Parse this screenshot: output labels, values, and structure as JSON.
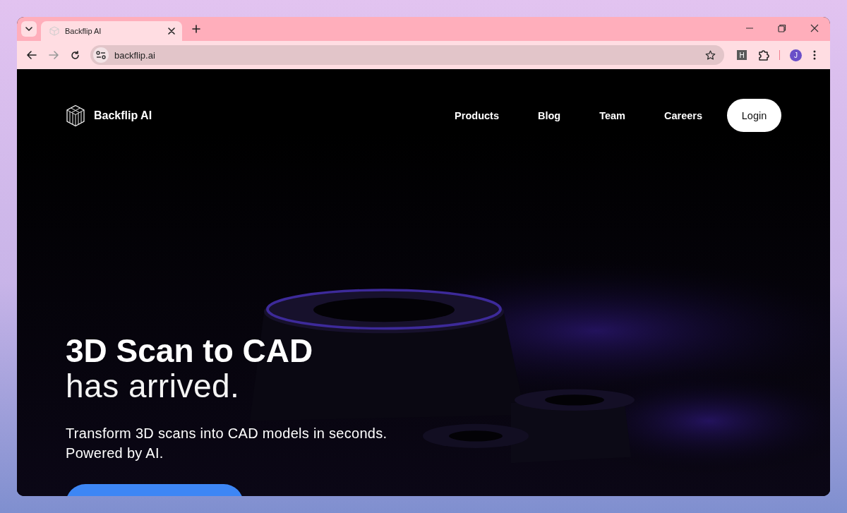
{
  "browser": {
    "tabs": [
      {
        "title": "Backflip AI",
        "selected": true
      }
    ],
    "address": "backflip.ai",
    "extension_badge": "H",
    "profile_initial": "J"
  },
  "site": {
    "brand": "Backflip AI",
    "nav": [
      "Products",
      "Blog",
      "Team",
      "Careers"
    ],
    "login": "Login"
  },
  "hero": {
    "title": "3D Scan to CAD",
    "title_line_2": "has arrived.",
    "subtitle_lines": [
      "Transform 3D scans into CAD models in seconds.",
      "Powered by AI."
    ]
  }
}
